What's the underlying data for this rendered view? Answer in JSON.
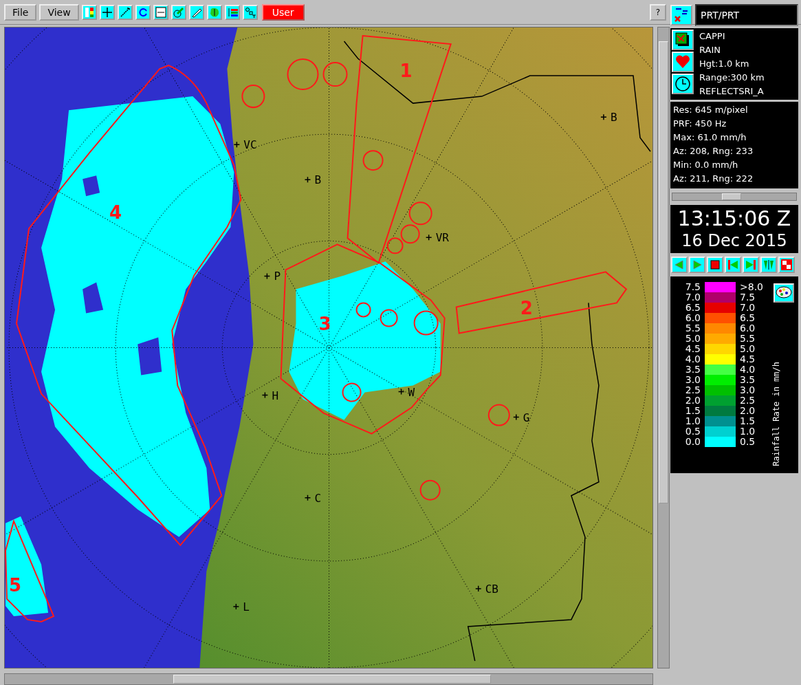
{
  "toolbar": {
    "menus": [
      {
        "label": "File"
      },
      {
        "label": "View"
      }
    ],
    "user_button": "User",
    "help_button": "?"
  },
  "site": "PRT/PRT",
  "product": [
    "CAPPI",
    "RAIN",
    "Hgt:1.0 km",
    "Range:300 km",
    "REFLECTSRI_A"
  ],
  "info": [
    "Res: 645 m/pixel",
    "PRF: 450 Hz",
    "Max: 61.0 mm/h",
    "Az:  208, Rng: 233",
    "Min:  0.0 mm/h",
    "Az:  211, Rng: 222"
  ],
  "time": "13:15:06 Z",
  "date": "16 Dec 2015",
  "legend": {
    "title": "Rainfall Rate in mm/h",
    "rows": [
      {
        "low": "7.5",
        "high": ">8.0",
        "color": "#ff00ff"
      },
      {
        "low": "7.0",
        "high": "7.5",
        "color": "#b0006a"
      },
      {
        "low": "6.5",
        "high": "7.0",
        "color": "#e60000"
      },
      {
        "low": "6.0",
        "high": "6.5",
        "color": "#ff5000"
      },
      {
        "low": "5.5",
        "high": "6.0",
        "color": "#ff8800"
      },
      {
        "low": "5.0",
        "high": "5.5",
        "color": "#ffaa00"
      },
      {
        "low": "4.5",
        "high": "5.0",
        "color": "#ffd700"
      },
      {
        "low": "4.0",
        "high": "4.5",
        "color": "#ffff00"
      },
      {
        "low": "3.5",
        "high": "4.0",
        "color": "#44ff44"
      },
      {
        "low": "3.0",
        "high": "3.5",
        "color": "#00ee00"
      },
      {
        "low": "2.5",
        "high": "3.0",
        "color": "#00c000"
      },
      {
        "low": "2.0",
        "high": "2.5",
        "color": "#00a030"
      },
      {
        "low": "1.5",
        "high": "2.0",
        "color": "#007a40"
      },
      {
        "low": "1.0",
        "high": "1.5",
        "color": "#009090"
      },
      {
        "low": "0.5",
        "high": "1.0",
        "color": "#00d0d0"
      },
      {
        "low": "0.0",
        "high": "0.5",
        "color": "#00ffff"
      }
    ]
  },
  "map": {
    "regions": [
      {
        "label": "1"
      },
      {
        "label": "2"
      },
      {
        "label": "3"
      },
      {
        "label": "4"
      },
      {
        "label": "5"
      }
    ],
    "places": [
      {
        "label": "B"
      },
      {
        "label": "VC"
      },
      {
        "label": "B"
      },
      {
        "label": "VR"
      },
      {
        "label": "P"
      },
      {
        "label": "H"
      },
      {
        "label": "W"
      },
      {
        "label": "G"
      },
      {
        "label": "C"
      },
      {
        "label": "CB"
      },
      {
        "label": "L"
      }
    ]
  }
}
